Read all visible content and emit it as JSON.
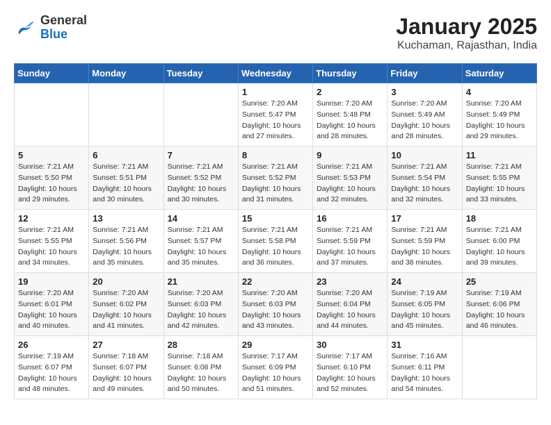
{
  "header": {
    "logo": {
      "general": "General",
      "blue": "Blue"
    },
    "title": "January 2025",
    "subtitle": "Kuchaman, Rajasthan, India"
  },
  "weekdays": [
    "Sunday",
    "Monday",
    "Tuesday",
    "Wednesday",
    "Thursday",
    "Friday",
    "Saturday"
  ],
  "weeks": [
    [
      null,
      null,
      null,
      {
        "day": "1",
        "sunrise": "Sunrise: 7:20 AM",
        "sunset": "Sunset: 5:47 PM",
        "daylight": "Daylight: 10 hours and 27 minutes."
      },
      {
        "day": "2",
        "sunrise": "Sunrise: 7:20 AM",
        "sunset": "Sunset: 5:48 PM",
        "daylight": "Daylight: 10 hours and 28 minutes."
      },
      {
        "day": "3",
        "sunrise": "Sunrise: 7:20 AM",
        "sunset": "Sunset: 5:49 AM",
        "daylight": "Daylight: 10 hours and 28 minutes."
      },
      {
        "day": "4",
        "sunrise": "Sunrise: 7:20 AM",
        "sunset": "Sunset: 5:49 PM",
        "daylight": "Daylight: 10 hours and 29 minutes."
      }
    ],
    [
      {
        "day": "5",
        "sunrise": "Sunrise: 7:21 AM",
        "sunset": "Sunset: 5:50 PM",
        "daylight": "Daylight: 10 hours and 29 minutes."
      },
      {
        "day": "6",
        "sunrise": "Sunrise: 7:21 AM",
        "sunset": "Sunset: 5:51 PM",
        "daylight": "Daylight: 10 hours and 30 minutes."
      },
      {
        "day": "7",
        "sunrise": "Sunrise: 7:21 AM",
        "sunset": "Sunset: 5:52 PM",
        "daylight": "Daylight: 10 hours and 30 minutes."
      },
      {
        "day": "8",
        "sunrise": "Sunrise: 7:21 AM",
        "sunset": "Sunset: 5:52 PM",
        "daylight": "Daylight: 10 hours and 31 minutes."
      },
      {
        "day": "9",
        "sunrise": "Sunrise: 7:21 AM",
        "sunset": "Sunset: 5:53 PM",
        "daylight": "Daylight: 10 hours and 32 minutes."
      },
      {
        "day": "10",
        "sunrise": "Sunrise: 7:21 AM",
        "sunset": "Sunset: 5:54 PM",
        "daylight": "Daylight: 10 hours and 32 minutes."
      },
      {
        "day": "11",
        "sunrise": "Sunrise: 7:21 AM",
        "sunset": "Sunset: 5:55 PM",
        "daylight": "Daylight: 10 hours and 33 minutes."
      }
    ],
    [
      {
        "day": "12",
        "sunrise": "Sunrise: 7:21 AM",
        "sunset": "Sunset: 5:55 PM",
        "daylight": "Daylight: 10 hours and 34 minutes."
      },
      {
        "day": "13",
        "sunrise": "Sunrise: 7:21 AM",
        "sunset": "Sunset: 5:56 PM",
        "daylight": "Daylight: 10 hours and 35 minutes."
      },
      {
        "day": "14",
        "sunrise": "Sunrise: 7:21 AM",
        "sunset": "Sunset: 5:57 PM",
        "daylight": "Daylight: 10 hours and 35 minutes."
      },
      {
        "day": "15",
        "sunrise": "Sunrise: 7:21 AM",
        "sunset": "Sunset: 5:58 PM",
        "daylight": "Daylight: 10 hours and 36 minutes."
      },
      {
        "day": "16",
        "sunrise": "Sunrise: 7:21 AM",
        "sunset": "Sunset: 5:59 PM",
        "daylight": "Daylight: 10 hours and 37 minutes."
      },
      {
        "day": "17",
        "sunrise": "Sunrise: 7:21 AM",
        "sunset": "Sunset: 5:59 PM",
        "daylight": "Daylight: 10 hours and 38 minutes."
      },
      {
        "day": "18",
        "sunrise": "Sunrise: 7:21 AM",
        "sunset": "Sunset: 6:00 PM",
        "daylight": "Daylight: 10 hours and 39 minutes."
      }
    ],
    [
      {
        "day": "19",
        "sunrise": "Sunrise: 7:20 AM",
        "sunset": "Sunset: 6:01 PM",
        "daylight": "Daylight: 10 hours and 40 minutes."
      },
      {
        "day": "20",
        "sunrise": "Sunrise: 7:20 AM",
        "sunset": "Sunset: 6:02 PM",
        "daylight": "Daylight: 10 hours and 41 minutes."
      },
      {
        "day": "21",
        "sunrise": "Sunrise: 7:20 AM",
        "sunset": "Sunset: 6:03 PM",
        "daylight": "Daylight: 10 hours and 42 minutes."
      },
      {
        "day": "22",
        "sunrise": "Sunrise: 7:20 AM",
        "sunset": "Sunset: 6:03 PM",
        "daylight": "Daylight: 10 hours and 43 minutes."
      },
      {
        "day": "23",
        "sunrise": "Sunrise: 7:20 AM",
        "sunset": "Sunset: 6:04 PM",
        "daylight": "Daylight: 10 hours and 44 minutes."
      },
      {
        "day": "24",
        "sunrise": "Sunrise: 7:19 AM",
        "sunset": "Sunset: 6:05 PM",
        "daylight": "Daylight: 10 hours and 45 minutes."
      },
      {
        "day": "25",
        "sunrise": "Sunrise: 7:19 AM",
        "sunset": "Sunset: 6:06 PM",
        "daylight": "Daylight: 10 hours and 46 minutes."
      }
    ],
    [
      {
        "day": "26",
        "sunrise": "Sunrise: 7:19 AM",
        "sunset": "Sunset: 6:07 PM",
        "daylight": "Daylight: 10 hours and 48 minutes."
      },
      {
        "day": "27",
        "sunrise": "Sunrise: 7:18 AM",
        "sunset": "Sunset: 6:07 PM",
        "daylight": "Daylight: 10 hours and 49 minutes."
      },
      {
        "day": "28",
        "sunrise": "Sunrise: 7:18 AM",
        "sunset": "Sunset: 6:08 PM",
        "daylight": "Daylight: 10 hours and 50 minutes."
      },
      {
        "day": "29",
        "sunrise": "Sunrise: 7:17 AM",
        "sunset": "Sunset: 6:09 PM",
        "daylight": "Daylight: 10 hours and 51 minutes."
      },
      {
        "day": "30",
        "sunrise": "Sunrise: 7:17 AM",
        "sunset": "Sunset: 6:10 PM",
        "daylight": "Daylight: 10 hours and 52 minutes."
      },
      {
        "day": "31",
        "sunrise": "Sunrise: 7:16 AM",
        "sunset": "Sunset: 6:11 PM",
        "daylight": "Daylight: 10 hours and 54 minutes."
      },
      null
    ]
  ]
}
